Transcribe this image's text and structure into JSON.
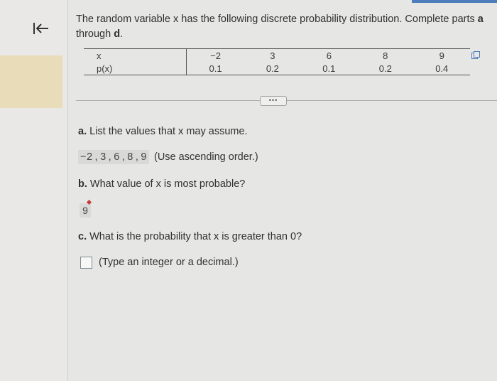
{
  "question_text": "The random variable x has the following discrete probability distribution. Complete parts a through d.",
  "question_prefix": "The random variable x has the following discrete probability distribution. Complete parts",
  "question_part_a_letter": "a",
  "question_through": "through",
  "question_part_d_letter": "d",
  "table": {
    "row_labels": [
      "x",
      "p(x)"
    ],
    "x_values": [
      "−2",
      "3",
      "6",
      "8",
      "9"
    ],
    "p_values": [
      "0.1",
      "0.2",
      "0.1",
      "0.2",
      "0.4"
    ]
  },
  "more_button_label": "•••",
  "part_a": {
    "letter": "a.",
    "text": "List the values that x may assume.",
    "answers": [
      "−2",
      "3",
      "6",
      "8",
      "9"
    ],
    "hint": "(Use ascending order.)"
  },
  "part_b": {
    "letter": "b.",
    "text": "What value of x is most probable?",
    "answer": "9"
  },
  "part_c": {
    "letter": "c.",
    "text": "What is the probability that x is greater than 0?",
    "input_value": "",
    "hint": "(Type an integer or a decimal.)"
  },
  "icons": {
    "back": "collapse-left-icon",
    "copy": "copy-icon"
  },
  "colors": {
    "accent": "#4e7dbb",
    "highlight": "#e9dcb9",
    "answer_bg": "#d9d9d7",
    "feedback_red": "#c23b3b"
  }
}
